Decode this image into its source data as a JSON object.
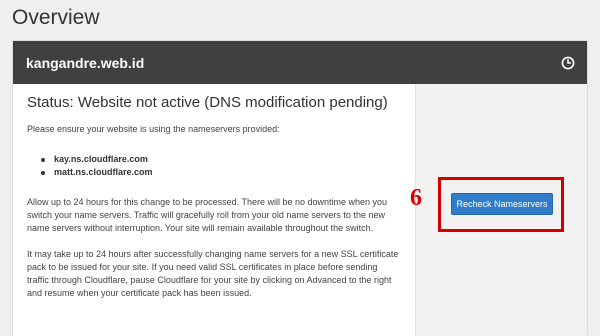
{
  "page": {
    "title": "Overview"
  },
  "card": {
    "domain": "kangandre.web.id",
    "status_heading": "Status: Website not active (DNS modification pending)",
    "intro": "Please ensure your website is using the nameservers provided:",
    "nameservers": [
      "kay.ns.cloudflare.com",
      "matt.ns.cloudflare.com"
    ],
    "paragraph_1": "Allow up to 24 hours for this change to be processed. There will be no downtime when you switch your name servers. Traffic will gracefully roll from your old name servers to the new name servers without interruption. Your site will remain available throughout the switch.",
    "paragraph_2": "It may take up to 24 hours after successfully changing name servers for a new SSL certificate pack to be issued for your site. If you need valid SSL certificates in place before sending traffic through Cloudflare, pause Cloudflare for your site by clicking on Advanced to the right and resume when your certificate pack has been issued.",
    "recheck_label": "Recheck Nameservers"
  },
  "annotation": {
    "step": "6"
  },
  "colors": {
    "header_bg": "#404040",
    "button_bg": "#2f7cc9",
    "annotation_red": "#d40000"
  }
}
